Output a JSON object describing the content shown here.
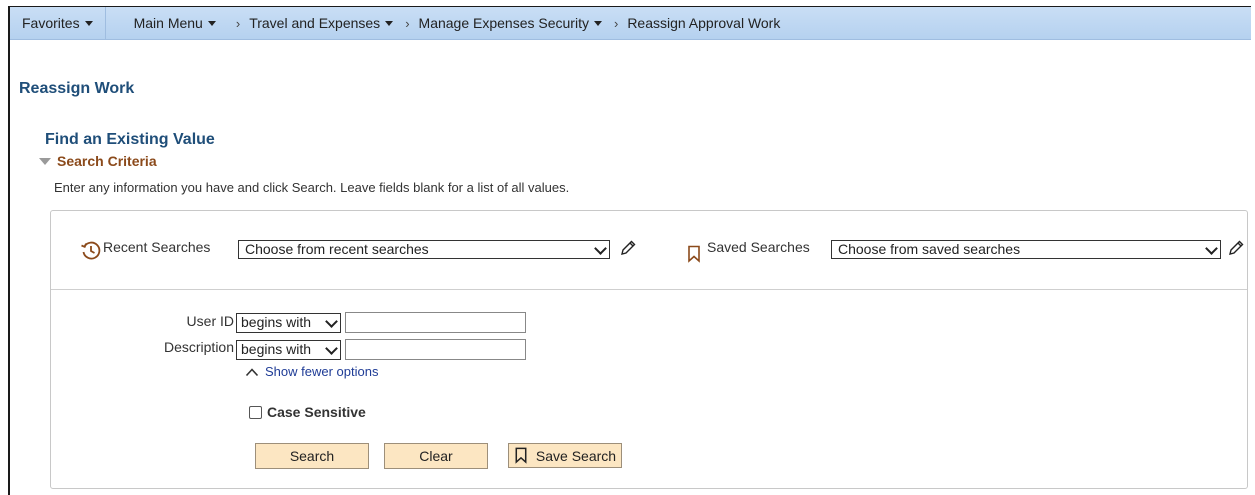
{
  "nav": {
    "favorites": "Favorites",
    "main_menu": "Main Menu",
    "breadcrumbs": [
      "Travel and Expenses",
      "Manage Expenses Security",
      "Reassign Approval Work"
    ]
  },
  "page": {
    "title": "Reassign Work",
    "section_title": "Find an Existing Value",
    "criteria_label": "Search Criteria",
    "instructions": "Enter any information you have and click Search. Leave fields blank for a list of all values."
  },
  "recent": {
    "label": "Recent Searches",
    "value": "Choose from recent searches"
  },
  "saved": {
    "label": "Saved Searches",
    "value": "Choose from saved searches"
  },
  "fields": {
    "user_id": {
      "label": "User ID",
      "operator": "begins with",
      "value": ""
    },
    "description": {
      "label": "Description",
      "operator": "begins with",
      "value": ""
    }
  },
  "options": {
    "show_fewer": "Show fewer options",
    "case_sensitive": "Case Sensitive",
    "case_sensitive_checked": false
  },
  "buttons": {
    "search": "Search",
    "clear": "Clear",
    "save_search": "Save Search"
  },
  "icons": {
    "recent": "history-clock-icon",
    "saved": "bookmark-icon",
    "edit": "pencil-icon",
    "collapse": "chevron-up-icon"
  },
  "colors": {
    "navbar": "#c9def5",
    "title": "#1f4e79",
    "criteria": "#8b4a1b",
    "link": "#1f3c96",
    "button": "#fce6c2"
  }
}
